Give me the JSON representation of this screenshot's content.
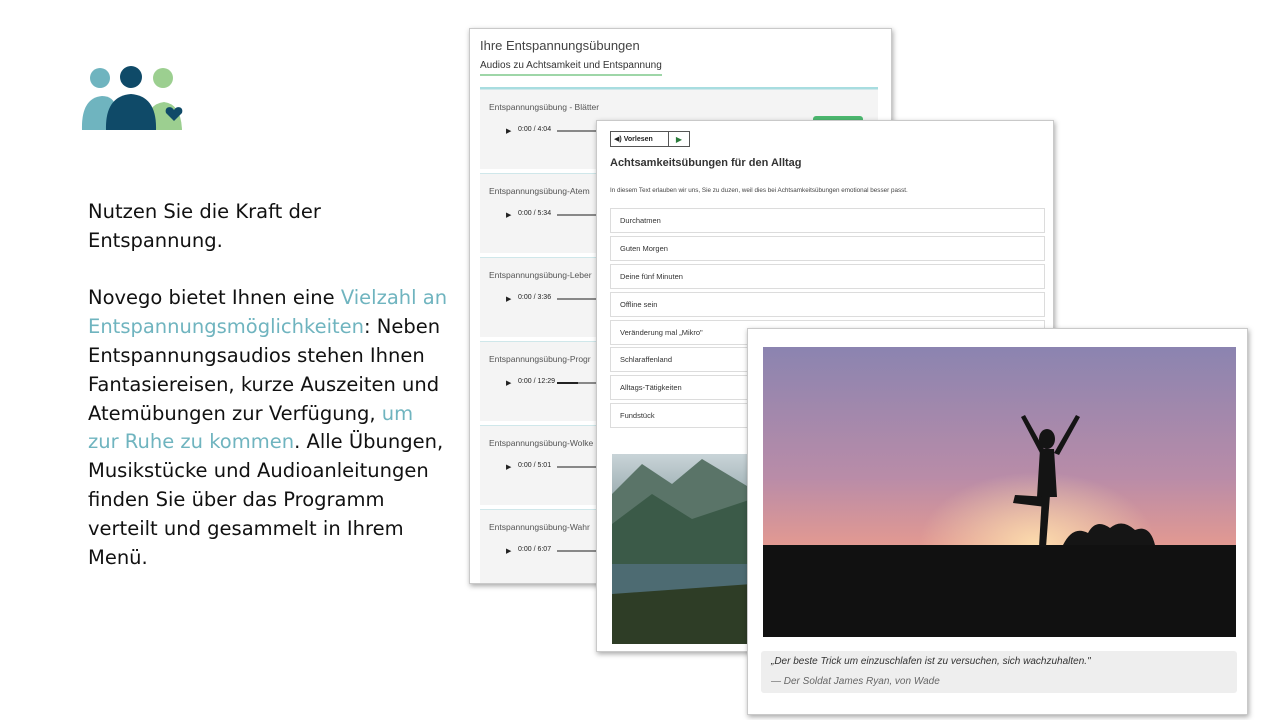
{
  "intro_text": {
    "headline": "Nutzen Sie die Kraft der Entspannung.",
    "p_part1": "Novego bietet Ihnen eine ",
    "p_highlight1": "Vielzahl an Entspannungsmöglichkeiten",
    "p_part2": ": Neben Entspannungsaudios stehen Ihnen Fantasiereisen, kurze Auszeiten und Atemübungen zur Verfügung, ",
    "p_highlight2": "um zur Ruhe zu kommen",
    "p_part3": ". Alle Übungen, Musikstücke und Audioanleitungen finden Sie über das Programm verteilt und gesammelt in Ihrem Menü."
  },
  "colors": {
    "highlight": "#6fb4bf",
    "logo_light": "#6fb4bf",
    "logo_dark": "#0f4a68",
    "logo_green": "#9ccf90"
  },
  "exercises_card": {
    "title": "Ihre Entspannungsübungen",
    "subtitle": "Audios zu Achtsamkeit und Entspannung",
    "items": [
      {
        "name": "Entspannungsübung - Blätter",
        "time": "0:00 / 4:04",
        "progress": 0.0
      },
      {
        "name": "Entspannungsübung-Atem",
        "time": "0:00 / 5:34",
        "progress": 0.0
      },
      {
        "name": "Entspannungsübung-Leber",
        "time": "0:00 / 3:36",
        "progress": 0.0
      },
      {
        "name": "Entspannungsübung-Progr",
        "time": "0:00 / 12:29",
        "progress": 0.35
      },
      {
        "name": "Entspannungsübung-Wolke",
        "time": "0:00 / 5:01",
        "progress": 0.0
      },
      {
        "name": "Entspannungsübung-Wahr",
        "time": "0:00 / 6:07",
        "progress": 0.0
      }
    ],
    "play_glyph": "▶"
  },
  "mindfulness_card": {
    "read_aloud": "Vorlesen",
    "title": "Achtsamkeitsübungen für den Alltag",
    "intro": "In diesem Text erlauben wir uns, Sie zu duzen, weil dies bei Achtsamkeitsübungen emotional besser passt.",
    "items": [
      "Durchatmen",
      "Guten Morgen",
      "Deine fünf Minuten",
      "Offline sein",
      "Veränderung mal „Mikro\"",
      "Schlaraffenland",
      "Alltags-Tätigkeiten",
      "Fundstück"
    ]
  },
  "quote_card": {
    "quote": "„Der beste Trick um einzuschlafen ist zu versuchen, sich wachzuhalten.\"",
    "author": "— Der Soldat James Ryan, von Wade"
  }
}
